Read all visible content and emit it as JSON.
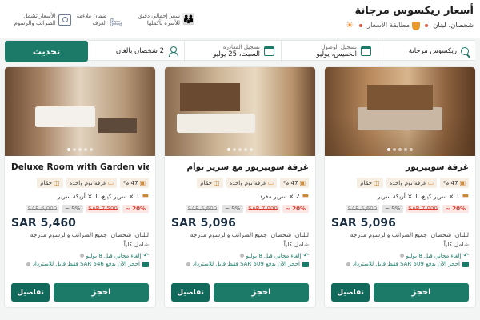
{
  "header": {
    "title": "أسعار ريكسوس مرجانة",
    "location": "شحصان، لبنان",
    "price_match": "مطابقة الأسعار"
  },
  "features": [
    {
      "icon": "people-icon",
      "text": "سعر إجمالي دقيق للأسرة بأكملها"
    },
    {
      "icon": "bed-icon",
      "text": "ضمان ملاءمة الغرفة"
    },
    {
      "icon": "money-icon",
      "text": "الأسعار تشمل الضرائب والرسوم"
    }
  ],
  "search": {
    "hotel": "ريكسوس مرجانة",
    "checkin_label": "تسجيل الوصول",
    "checkin_value": "الخميس، يوليو",
    "checkout_label": "تسجيل المغادرة",
    "checkout_value": "السبت، 25 يوليو",
    "guests": "2 شخصان بالغان",
    "update_label": "تحديث"
  },
  "rooms": [
    {
      "name": "غرفة سوبيريور",
      "area": "47 م²",
      "bedroom": "غرفة نوم واحدة",
      "bath": "حمّام",
      "beds": "1 × سرير كينغ، 1 × أريكة سرير",
      "discount_red": "20% ~",
      "old_red": "SAR 7,000",
      "discount_grey": "9% ~",
      "old_grey": "SAR 5,600",
      "price": "SAR 5,096",
      "tax": "لبلنان، شحصان، جميع الضرائب والرسوم مدرجة",
      "meal": "شامل كلياً",
      "perk_cancel": "إلغاء مجاني قبل 8 يوليو",
      "perk_pay": "احجز الآن بدفع SAR 509 فقط قابل للاسترداد",
      "book": "احجز",
      "details": "تفاصيل"
    },
    {
      "name": "غرفة سوبيريور مع سرير توأم",
      "area": "47 م²",
      "bedroom": "غرفة نوم واحدة",
      "bath": "حمّام",
      "beds": "2 × سرير مفرد",
      "discount_red": "20% ~",
      "old_red": "SAR 7,000",
      "discount_grey": "9% ~",
      "old_grey": "SAR 5,600",
      "price": "SAR 5,096",
      "tax": "لبلنان، شحصان، جميع الضرائب والرسوم مدرجة",
      "meal": "شامل كلياً",
      "perk_cancel": "إلغاء مجاني قبل 8 يوليو",
      "perk_pay": "احجز الآن بدفع SAR 509 فقط قابل للاسترداد",
      "book": "احجز",
      "details": "تفاصيل"
    },
    {
      "name": "Deluxe Room with Garden view",
      "area": "47 م²",
      "bedroom": "غرفة نوم واحدة",
      "bath": "حمّام",
      "beds": "1 × سرير كينغ، 1 × أريكة سرير",
      "discount_red": "20% ~",
      "old_red": "SAR 7,500",
      "discount_grey": "9% ~",
      "old_grey": "SAR 6,000",
      "price": "SAR 5,460",
      "tax": "لبلنان، شحصان، جميع الضرائب والرسوم مدرجة",
      "meal": "شامل كلياً",
      "perk_cancel": "إلغاء مجاني قبل 8 يوليو",
      "perk_pay": "احجز الآن بدفع SAR 546 فقط قابل للاسترداد",
      "book": "احجز",
      "details": "تفاصيل"
    }
  ],
  "colors": {
    "accent": "#1b7a68",
    "discount": "#d83c2e",
    "price": "#1a2d3f"
  }
}
